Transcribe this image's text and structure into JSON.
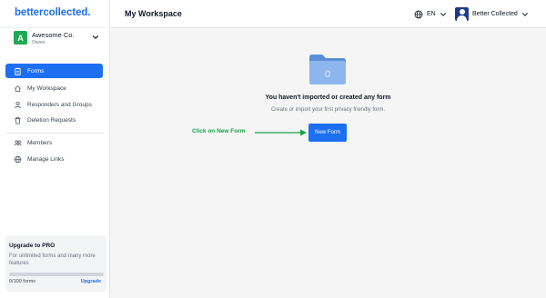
{
  "app": {
    "logo": "bettercollected."
  },
  "workspace": {
    "avatar_letter": "A",
    "name": "Awesome Co.",
    "role": "Owner"
  },
  "sidebar": {
    "items": [
      {
        "label": "Forms",
        "icon": "clipboard-icon",
        "active": true
      },
      {
        "label": "My Workspace",
        "icon": "home-icon",
        "active": false
      },
      {
        "label": "Responders and Groups",
        "icon": "user-icon",
        "active": false
      },
      {
        "label": "Deletion Requests",
        "icon": "trash-icon",
        "active": false
      },
      {
        "label": "Members",
        "icon": "users-icon",
        "active": false
      },
      {
        "label": "Manage Links",
        "icon": "globe-icon",
        "active": false
      }
    ]
  },
  "upgrade": {
    "title": "Upgrade to PRO",
    "description": "For unlimited forms and many more features",
    "count_label": "0/100 forms",
    "progress_fraction": 0,
    "link": "Upgrade"
  },
  "header": {
    "title": "My Workspace",
    "language": "EN",
    "user_name": "Better Collected"
  },
  "empty_state": {
    "folder_count": "0",
    "title": "You haven't imported or created any form",
    "subtitle": "Create or import your first privacy friendly form.",
    "button": "New Form",
    "annotation": "Click on New Form"
  },
  "colors": {
    "accent": "#1d6ff2",
    "annotation": "#16a34a",
    "avatar": "#22a854"
  }
}
